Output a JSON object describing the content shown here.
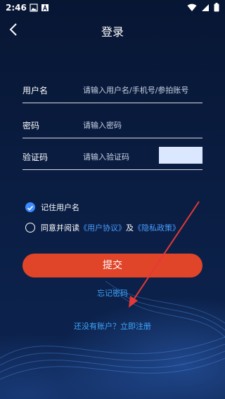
{
  "status_bar": {
    "time": "2:46",
    "icons_left": [
      "image-icon",
      "a-letter-icon"
    ],
    "icons_right": [
      "wifi-icon",
      "signal-icon",
      "battery-icon"
    ]
  },
  "header": {
    "title": "登录",
    "back_icon": "chevron-left-icon"
  },
  "form": {
    "username": {
      "label": "用户名",
      "placeholder": "请输入用户名/手机号/参拍账号"
    },
    "password": {
      "label": "密码",
      "placeholder": "请输入密码"
    },
    "captcha": {
      "label": "验证码",
      "placeholder": "请输入验证码"
    },
    "remember": {
      "label": "记住用户名",
      "checked": true
    },
    "agreement": {
      "prefix": "同意并阅读",
      "user_agreement": "《用户协议》",
      "and": "及",
      "privacy_policy": "《隐私政策》",
      "checked": false
    },
    "submit_label": "提交",
    "forgot_label": "忘记密码",
    "register_label": "还没有账户？立即注册"
  },
  "colors": {
    "background": "#0a1b3d",
    "accent_button": "#e0452a",
    "link": "#3ea7ff",
    "annotation_arrow": "#e53935"
  }
}
